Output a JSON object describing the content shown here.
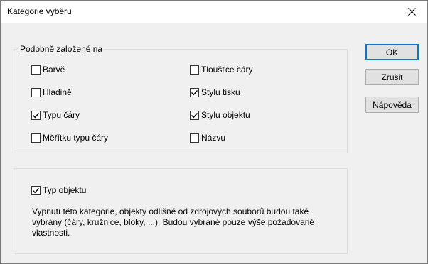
{
  "window": {
    "title": "Kategorie výběru",
    "close_icon": "close-icon"
  },
  "group_based_on": {
    "label": "Podobně založené na",
    "options": [
      {
        "label": "Barvě",
        "checked": false
      },
      {
        "label": "Hladině",
        "checked": false
      },
      {
        "label": "Typu čáry",
        "checked": true
      },
      {
        "label": "Měřítku typu čáry",
        "checked": false
      },
      {
        "label": "Tloušťce čáry",
        "checked": false
      },
      {
        "label": "Stylu tisku",
        "checked": true
      },
      {
        "label": "Stylu objektu",
        "checked": true
      },
      {
        "label": "Názvu",
        "checked": false
      }
    ]
  },
  "object_type": {
    "label": "Typ objektu",
    "checked": true,
    "description": "Vypnutí této kategorie, objekty odlišné od zdrojových souborů budou také vybrány (čáry, kružnice, bloky, ...). Budou vybrané pouze výše požadované vlastnosti."
  },
  "buttons": {
    "ok": "OK",
    "cancel": "Zrušit",
    "help": "Nápověda"
  }
}
